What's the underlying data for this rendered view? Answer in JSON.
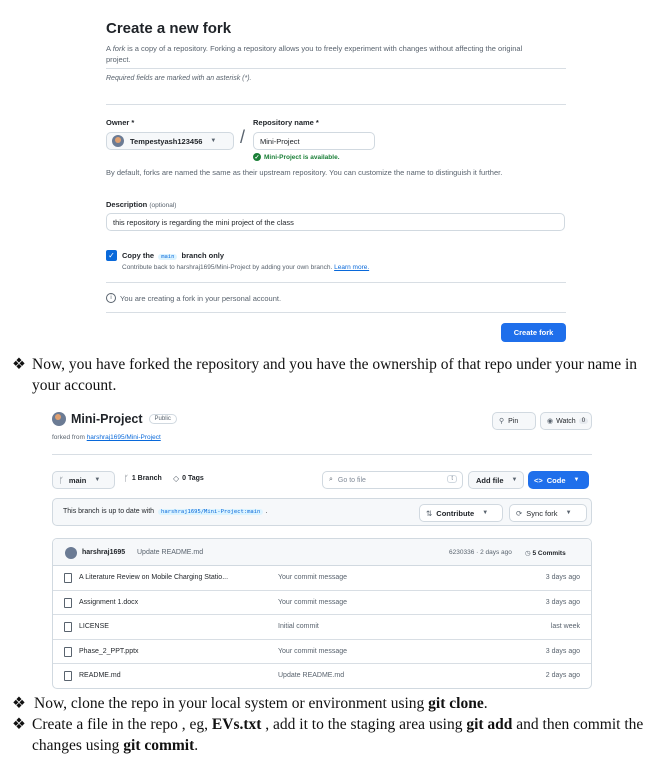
{
  "fork_form": {
    "title": "Create a new fork",
    "intro_prefix": "A ",
    "intro_em": "fork",
    "intro_suffix": " is a copy of a repository. Forking a repository allows you to freely experiment with changes without affecting the original project.",
    "required_note": "Required fields are marked with an asterisk (*).",
    "owner_label": "Owner *",
    "owner_value": "Tempestyash123456",
    "repo_name_label": "Repository name *",
    "repo_name_value": "Mini-Project",
    "availability": "Mini-Project is available.",
    "default_note": "By default, forks are named the same as their upstream repository. You can customize the name to distinguish it further.",
    "description_label": "Description",
    "description_optional": "(optional)",
    "description_value": "this repository is regarding the mini project of the class",
    "copy_prefix": "Copy the",
    "copy_branch": "main",
    "copy_suffix": "branch only",
    "copy_checked": true,
    "copy_help": "Contribute back to harshraj1695/Mini-Project by adding your own branch.",
    "learn_more": "Learn more.",
    "personal_note": "You are creating a fork in your personal account.",
    "create_button": "Create fork",
    "button_color": "#1f6feb"
  },
  "prose": {
    "p1": "Now, you have forked the repository and you have the ownership of that repo under your name in your account.",
    "p2_prefix": "Now, clone the repo in your local system or environment using ",
    "p2_bold": "git clone",
    "p2_suffix": ".",
    "p3_a": "Create a file in the repo , eg, ",
    "p3_b": "EVs.txt",
    "p3_c": " , add it to the staging area using ",
    "p3_d": "git add",
    "p3_e": " and then commit the changes using ",
    "p3_f": "git commit",
    "p3_g": ".",
    "bullet_symbol": "❖"
  },
  "repo": {
    "name": "Mini-Project",
    "visibility": "Public",
    "forked_prefix": "forked from ",
    "forked_link": "harshraj1695/Mini-Project",
    "pin": "Pin",
    "watch": "Watch",
    "watch_count": "0",
    "branch": "main",
    "branches": "1 Branch",
    "tags": "0 Tags",
    "search_placeholder": "Go to file",
    "search_key": "t",
    "add_file": "Add file",
    "code": "Code",
    "status_text": "This branch is up to date with",
    "status_ref": "harshraj1695/Mini-Project:main",
    "contribute": "Contribute",
    "sync_fork": "Sync fork",
    "last_commit": {
      "user": "harshraj1695",
      "message": "Update README.md",
      "sha_time": "6230336 · 2 days ago",
      "commits": "5 Commits"
    },
    "files": [
      {
        "name": "A Literature Review on Mobile Charging Statio...",
        "message": "Your commit message",
        "date": "3 days ago"
      },
      {
        "name": "Assignment 1.docx",
        "message": "Your commit message",
        "date": "3 days ago"
      },
      {
        "name": "LICENSE",
        "message": "Initial commit",
        "date": "last week"
      },
      {
        "name": "Phase_2_PPT.pptx",
        "message": "Your commit message",
        "date": "3 days ago"
      },
      {
        "name": "README.md",
        "message": "Update README.md",
        "date": "2 days ago"
      }
    ]
  }
}
